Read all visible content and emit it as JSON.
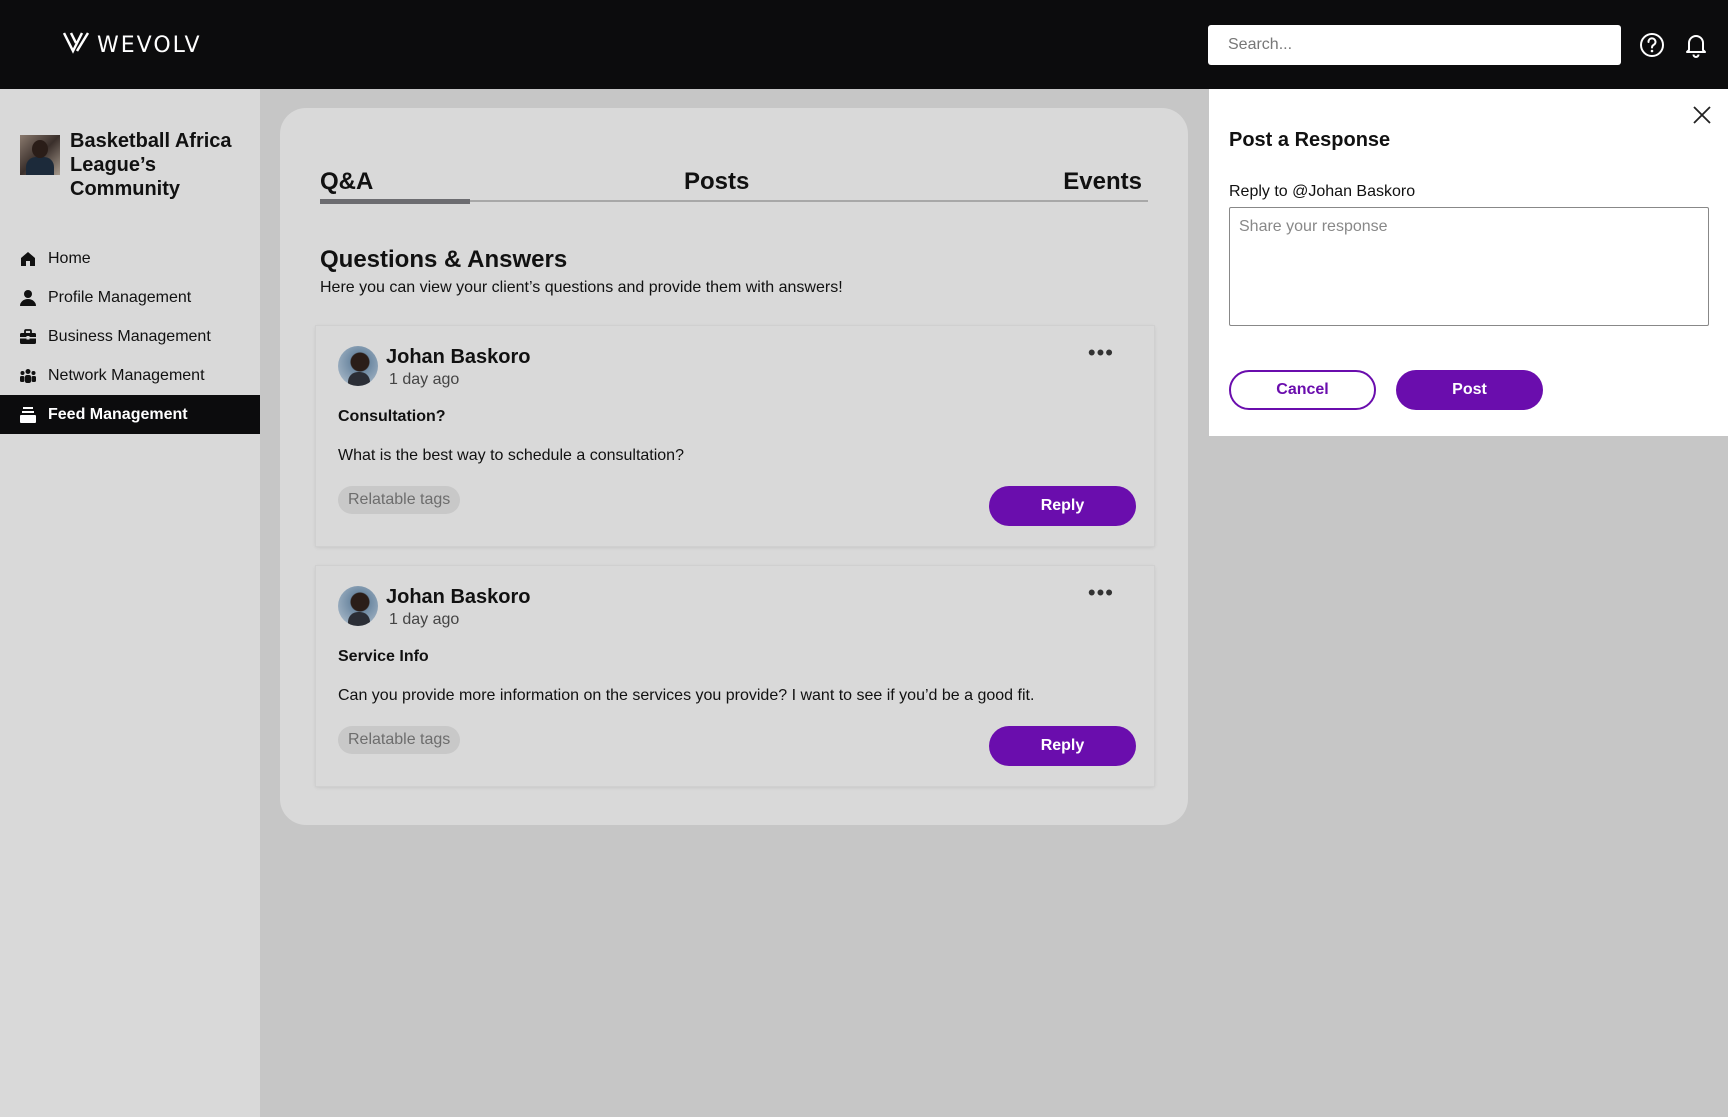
{
  "header": {
    "brand": "WEVOLV",
    "search_placeholder": "Search...",
    "icons": [
      "help-icon",
      "bell-icon"
    ]
  },
  "sidebar": {
    "community_name": "Basketball Africa League’s Community",
    "items": [
      {
        "label": "Home",
        "icon": "home-icon",
        "active": false
      },
      {
        "label": "Profile Management",
        "icon": "person-icon",
        "active": false
      },
      {
        "label": "Business Management",
        "icon": "briefcase-icon",
        "active": false
      },
      {
        "label": "Network Management",
        "icon": "group-icon",
        "active": false
      },
      {
        "label": "Feed Management",
        "icon": "feed-icon",
        "active": true
      }
    ]
  },
  "main": {
    "tabs": [
      {
        "label": "Q&A",
        "active": true
      },
      {
        "label": "Posts",
        "active": false
      },
      {
        "label": "Events",
        "active": false
      }
    ],
    "title": "Questions & Answers",
    "subtitle": "Here you can view your client’s questions and provide them with answers!",
    "questions": [
      {
        "author": "Johan Baskoro",
        "time": "1 day ago",
        "title": "Consultation?",
        "body": "What is the best way to schedule a consultation?",
        "tag": "Relatable tags",
        "reply_label": "Reply"
      },
      {
        "author": "Johan Baskoro",
        "time": "1 day ago",
        "title": "Service Info",
        "body": "Can you provide more information on the services you provide? I want to see if you’d be a good fit.",
        "tag": "Relatable tags",
        "reply_label": "Reply"
      }
    ]
  },
  "panel": {
    "title": "Post a Response",
    "reply_to": "Reply to @Johan Baskoro",
    "textarea_placeholder": "Share your response",
    "cancel_label": "Cancel",
    "post_label": "Post"
  },
  "colors": {
    "topbar": "#0c0c0d",
    "accent": "#6a0dad",
    "sidebar_bg": "#d9d9d9",
    "page_bg": "#c6c6c6"
  }
}
